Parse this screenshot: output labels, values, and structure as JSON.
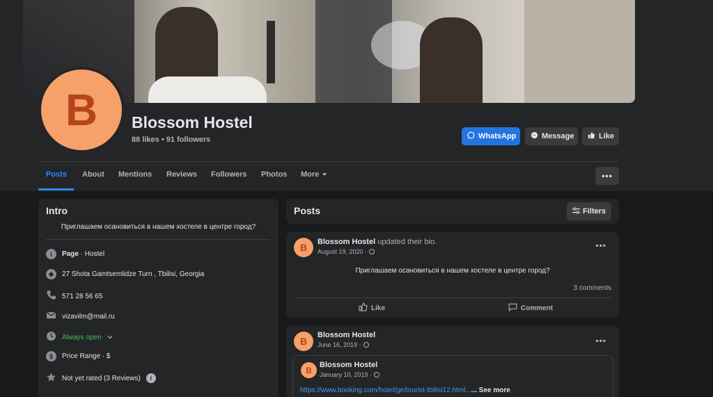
{
  "page": {
    "name": "Blossom Hostel",
    "avatar_letter": "B",
    "stats": "88 likes • 91 followers"
  },
  "actions": {
    "whatsapp": "WhatsApp",
    "message": "Message",
    "like": "Like"
  },
  "tabs": [
    {
      "label": "Posts",
      "active": true
    },
    {
      "label": "About"
    },
    {
      "label": "Mentions"
    },
    {
      "label": "Reviews"
    },
    {
      "label": "Followers"
    },
    {
      "label": "Photos"
    },
    {
      "label": "More"
    }
  ],
  "more_button": "•••",
  "intro": {
    "title": "Intro",
    "bio": "Приглашаем осановиться в нашем хостеле в центре город?",
    "page_label": "Page",
    "page_category": " · Hostel",
    "address": "27 Shota Gamtsemlidze Turn , Tbilisi, Georgia",
    "phone": "571 28 56 65",
    "email": "vizavilm@mail.ru",
    "hours": "Always open",
    "price": "Price Range · $",
    "rating": "Not yet rated (3 Reviews)"
  },
  "posts_header": {
    "title": "Posts",
    "filters": "Filters"
  },
  "posts": [
    {
      "author": "Blossom Hostel",
      "action": " updated their bio.",
      "date": "August 19, 2020 ·",
      "text": "Приглашаем осановиться в нашем хостеле в центре город?",
      "comments": "3 comments",
      "like_label": "Like",
      "comment_label": "Comment"
    },
    {
      "author": "Blossom Hostel",
      "date": "June 16, 2019 ·",
      "shared": {
        "author": "Blossom Hostel",
        "date": "January 10, 2019 ·",
        "link": "https://www.booking.com/hotel/ge/tourist-tbilisi12.html...",
        "see_more": "... See more"
      }
    }
  ],
  "colors": {
    "accent": "#2d88ff",
    "whatsapp_button": "#2374e1",
    "avatar_bg": "#f6a06a",
    "avatar_letter": "#b5451b",
    "open_green": "#45bd62"
  }
}
